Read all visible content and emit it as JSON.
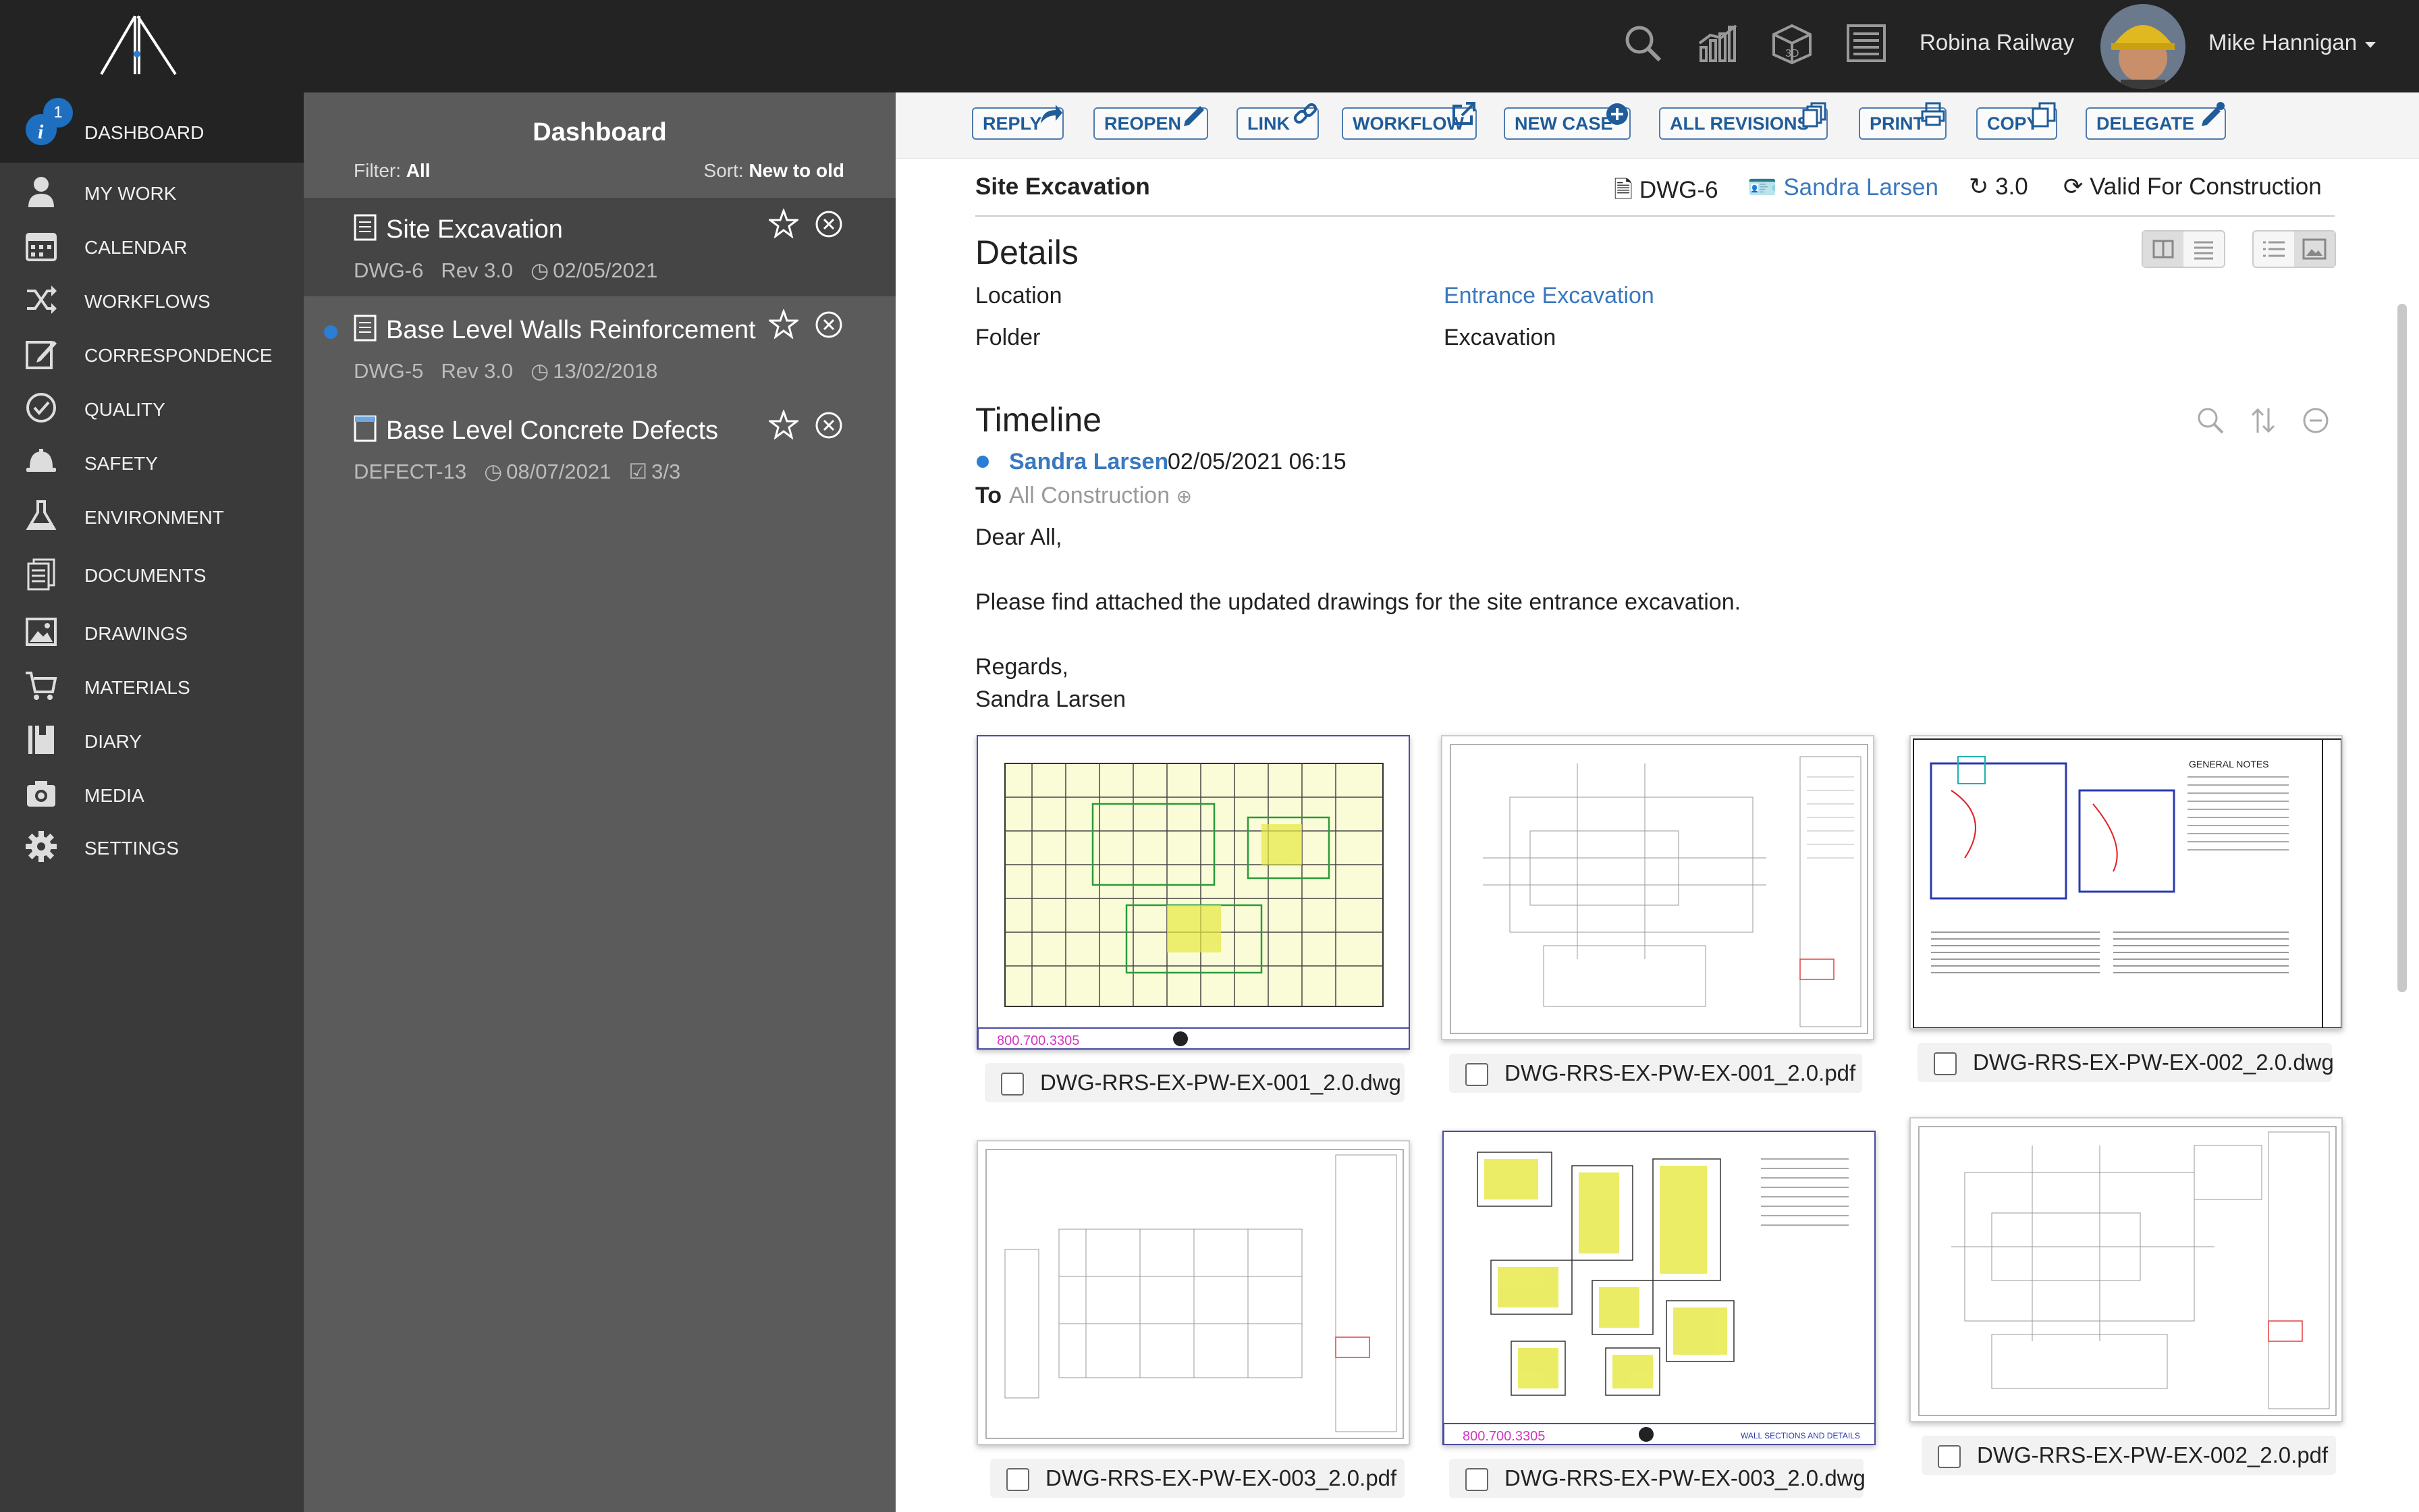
{
  "topbar": {
    "project": "Robina Railway",
    "user": "Mike Hannigan",
    "icons": [
      "logo-icon",
      "search-icon",
      "reports-icon",
      "3d-model-icon",
      "register-icon"
    ]
  },
  "sidebar": {
    "badge": "1",
    "items": [
      {
        "label": "DASHBOARD",
        "icon": "info-icon"
      },
      {
        "label": "MY WORK",
        "icon": "person-icon"
      },
      {
        "label": "CALENDAR",
        "icon": "calendar-icon"
      },
      {
        "label": "WORKFLOWS",
        "icon": "shuffle-icon"
      },
      {
        "label": "CORRESPONDENCE",
        "icon": "edit-icon"
      },
      {
        "label": "QUALITY",
        "icon": "check-circle-icon"
      },
      {
        "label": "SAFETY",
        "icon": "hardhat-icon"
      },
      {
        "label": "ENVIRONMENT",
        "icon": "flask-icon"
      },
      {
        "label": "DOCUMENTS",
        "icon": "documents-icon"
      },
      {
        "label": "DRAWINGS",
        "icon": "image-icon"
      },
      {
        "label": "MATERIALS",
        "icon": "cart-icon"
      },
      {
        "label": "DIARY",
        "icon": "diary-icon"
      },
      {
        "label": "MEDIA",
        "icon": "camera-icon"
      },
      {
        "label": "SETTINGS",
        "icon": "gear-icon"
      }
    ]
  },
  "list": {
    "title": "Dashboard",
    "filter_label": "Filter:",
    "filter_value": "All",
    "sort_label": "Sort:",
    "sort_value": "New to old",
    "items": [
      {
        "title": "Site Excavation",
        "code": "DWG-6",
        "rev": "Rev 3.0",
        "date": "02/05/2021"
      },
      {
        "title": "Base Level Walls Reinforcement",
        "code": "DWG-5",
        "rev": "Rev 3.0",
        "date": "13/02/2018"
      },
      {
        "title": "Base Level Concrete Defects",
        "code": "DEFECT-13",
        "date": "08/07/2021",
        "progress": "3/3"
      }
    ]
  },
  "toolbar": {
    "buttons": [
      "REPLY",
      "REOPEN",
      "LINK",
      "WORKFLOW",
      "NEW CASE",
      "ALL REVISIONS",
      "PRINT",
      "COPY",
      "DELEGATE"
    ]
  },
  "case": {
    "title": "Site Excavation",
    "code": "DWG-6",
    "owner": "Sandra Larsen",
    "revision": "3.0",
    "status": "Valid For Construction"
  },
  "details": {
    "heading": "Details",
    "location_label": "Location",
    "location_value": "Entrance Excavation",
    "folder_label": "Folder",
    "folder_value": "Excavation"
  },
  "timeline": {
    "heading": "Timeline",
    "from": "Sandra Larsen",
    "datetime": "02/05/2021 06:15",
    "to_label": "To",
    "to_value": "All Construction",
    "body": [
      "Dear All,",
      "Please find attached the updated drawings for the site entrance excavation.",
      "Regards,",
      "Sandra Larsen"
    ]
  },
  "attachments": [
    {
      "name": "DWG-RRS-EX-PW-EX-001_2.0.dwg",
      "phone": "800.700.3305"
    },
    {
      "name": "DWG-RRS-EX-PW-EX-001_2.0.pdf"
    },
    {
      "name": "DWG-RRS-EX-PW-EX-002_2.0.dwg",
      "note": "GENERAL NOTES"
    },
    {
      "name": "DWG-RRS-EX-PW-EX-003_2.0.pdf"
    },
    {
      "name": "DWG-RRS-EX-PW-EX-003_2.0.dwg",
      "phone": "800.700.3305",
      "note": "WALL SECTIONS AND DETAILS"
    },
    {
      "name": "DWG-RRS-EX-PW-EX-002_2.0.pdf"
    }
  ],
  "colors": {
    "accent": "#3a78bf",
    "topbar": "#232323",
    "sidebar": "#3a3a3a",
    "list": "#5b5b5b"
  }
}
